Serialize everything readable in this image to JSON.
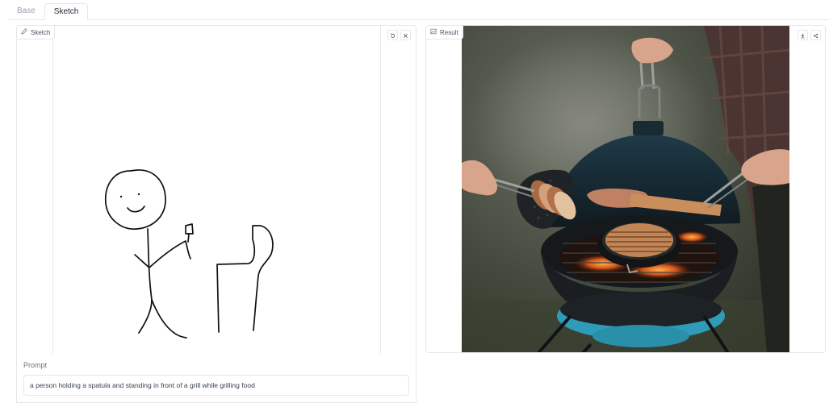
{
  "tabs": [
    {
      "label": "Base",
      "active": false
    },
    {
      "label": "Sketch",
      "active": true
    }
  ],
  "sketch_panel": {
    "label": "Sketch",
    "icons": [
      "pencil-icon",
      "undo-icon",
      "close-icon"
    ]
  },
  "result_panel": {
    "label": "Result",
    "icons": [
      "image-icon",
      "download-icon",
      "share-icon"
    ]
  },
  "prompt": {
    "label": "Prompt",
    "value": "a person holding a spatula and standing in front of a grill while grilling food"
  },
  "colors": {
    "border": "#e5e7eb",
    "text": "#374151",
    "muted": "#9ca3af",
    "grill_teal": "#2e9cb8",
    "grill_black": "#1b2428"
  }
}
